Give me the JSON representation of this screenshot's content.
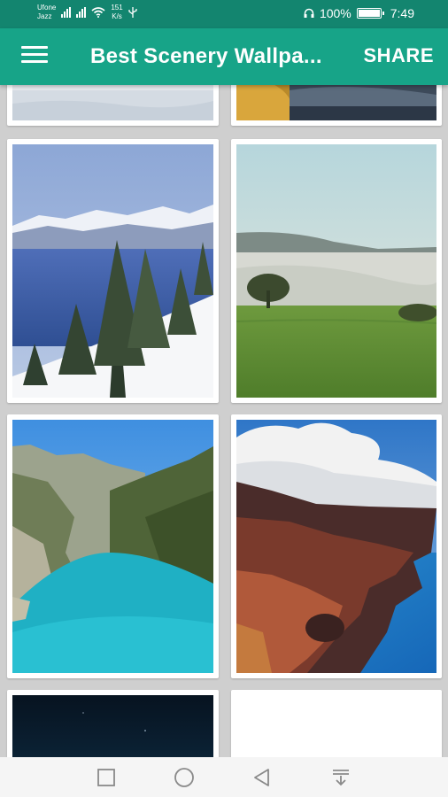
{
  "status_bar": {
    "carrier_line1": "Ufone",
    "carrier_line2": "Jazz",
    "net_speed_line1": "151",
    "net_speed_line2": "K/s",
    "battery_text": "100%",
    "battery_level": 1.0,
    "time": "7:49",
    "icons": [
      "signal-icon",
      "wifi-icon",
      "usb-icon",
      "headphones-icon",
      "battery-icon"
    ]
  },
  "app_bar": {
    "menu_icon": "menu-icon",
    "title": "Best Scenery Wallpa...",
    "share_label": "SHARE",
    "color": "#17a488",
    "status_color": "#13856f"
  },
  "wallpapers": [
    {
      "subject": "snowy field"
    },
    {
      "subject": "autumn leaves by water"
    },
    {
      "subject": "snowy lake with pine trees"
    },
    {
      "subject": "misty green meadow"
    },
    {
      "subject": "turquoise river canyon"
    },
    {
      "subject": "coastal cliffs with clouds"
    },
    {
      "subject": "night sky"
    },
    {
      "subject": "empty"
    }
  ],
  "nav_bar": {
    "icons": [
      "recents-square-icon",
      "home-circle-icon",
      "back-triangle-icon",
      "notification-pull-icon"
    ]
  }
}
